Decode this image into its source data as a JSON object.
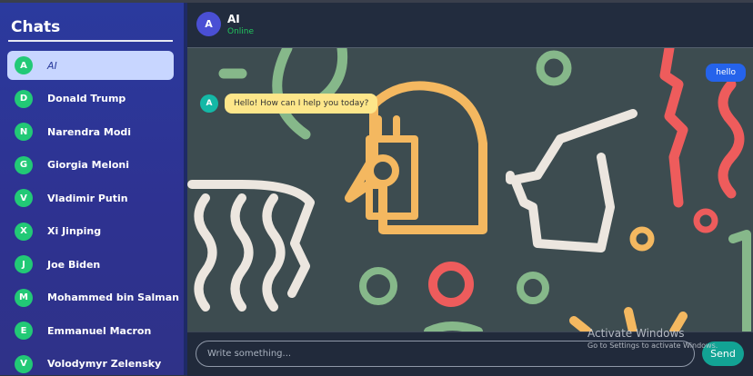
{
  "sidebar": {
    "title": "Chats",
    "items": [
      {
        "initial": "A",
        "name": "AI",
        "active": true
      },
      {
        "initial": "D",
        "name": "Donald Trump"
      },
      {
        "initial": "N",
        "name": "Narendra Modi"
      },
      {
        "initial": "G",
        "name": "Giorgia Meloni"
      },
      {
        "initial": "V",
        "name": "Vladimir Putin"
      },
      {
        "initial": "X",
        "name": "Xi Jinping"
      },
      {
        "initial": "J",
        "name": "Joe Biden"
      },
      {
        "initial": "M",
        "name": "Mohammed bin Salman"
      },
      {
        "initial": "E",
        "name": "Emmanuel Macron"
      },
      {
        "initial": "V",
        "name": "Volodymyr Zelensky"
      }
    ]
  },
  "header": {
    "avatar_initial": "A",
    "name": "AI",
    "status": "Online",
    "status_color": "#22c55e"
  },
  "messages": {
    "outgoing": "hello",
    "incoming_avatar": "A",
    "incoming": "Hello! How can I help you today?"
  },
  "composer": {
    "placeholder": "Write something...",
    "send_label": "Send"
  },
  "watermark": {
    "title": "Activate Windows",
    "subtitle": "Go to Settings to activate Windows."
  },
  "colors": {
    "sidebar": "#2e3291",
    "accent_green": "#22c976",
    "send": "#12a394",
    "outgoing_bubble": "#2563eb",
    "incoming_bubble": "#fde68a"
  }
}
